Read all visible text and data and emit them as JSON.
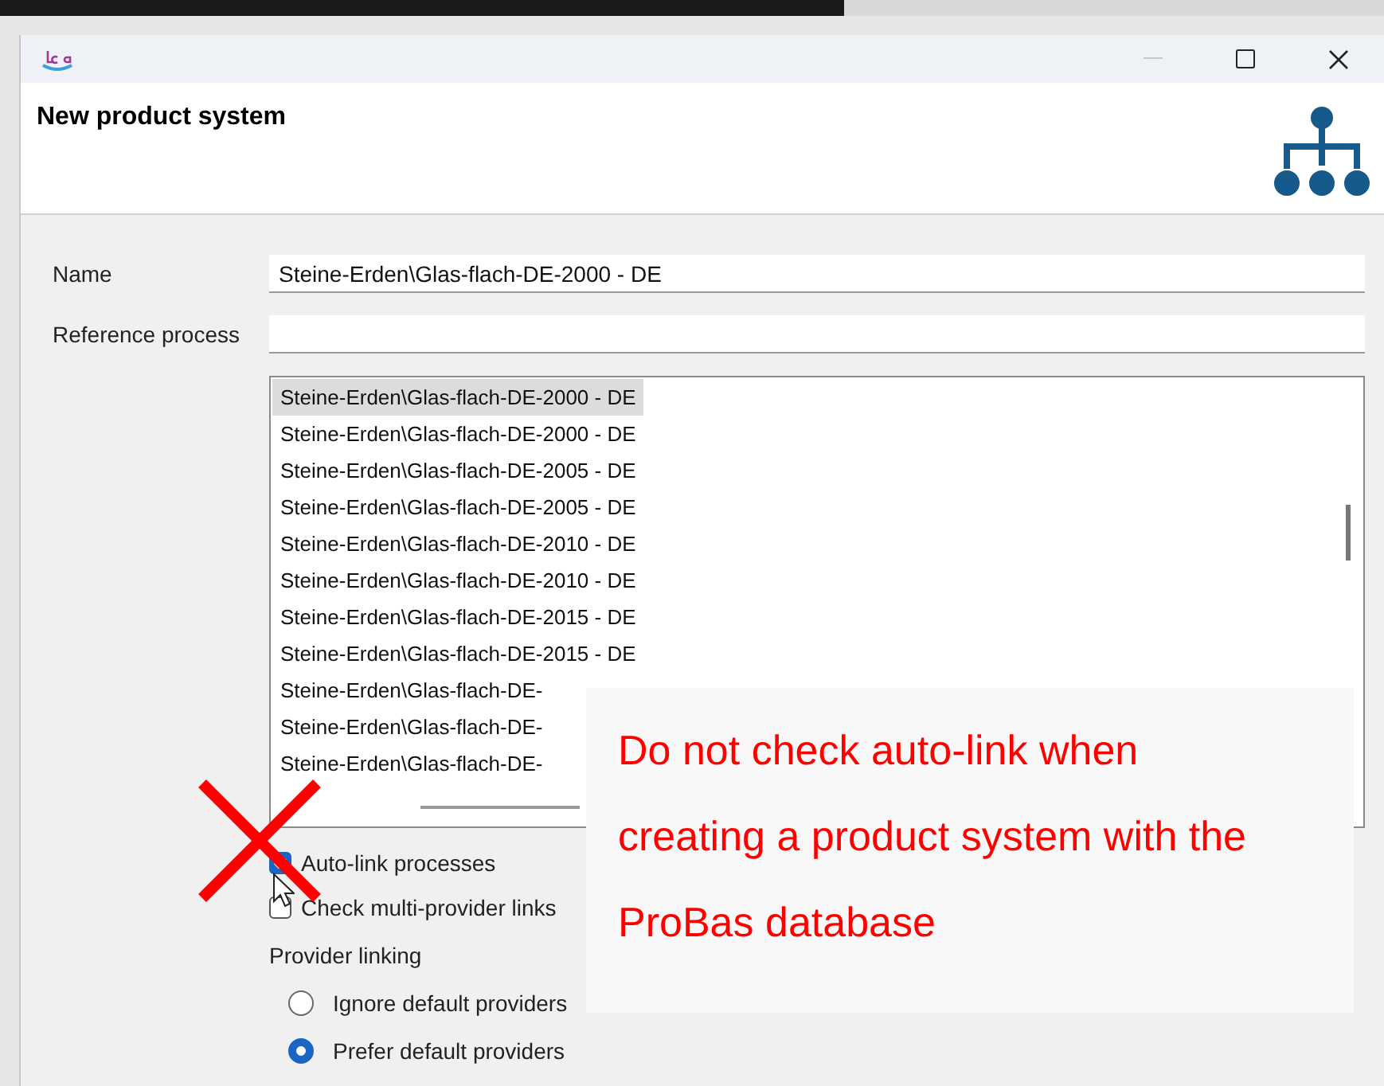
{
  "window": {
    "minimize_disabled": true,
    "title": "New product system"
  },
  "form": {
    "name_label": "Name",
    "name_value": "Steine-Erden\\Glas-flach-DE-2000 - DE",
    "reference_label": "Reference process"
  },
  "process_list": {
    "items": [
      {
        "label": "Steine-Erden\\Glas-flach-DE-2000 - DE",
        "selected": true
      },
      {
        "label": "Steine-Erden\\Glas-flach-DE-2000 - DE",
        "selected": false
      },
      {
        "label": "Steine-Erden\\Glas-flach-DE-2005 - DE",
        "selected": false
      },
      {
        "label": "Steine-Erden\\Glas-flach-DE-2005 - DE",
        "selected": false
      },
      {
        "label": "Steine-Erden\\Glas-flach-DE-2010 - DE",
        "selected": false
      },
      {
        "label": "Steine-Erden\\Glas-flach-DE-2010 - DE",
        "selected": false
      },
      {
        "label": "Steine-Erden\\Glas-flach-DE-2015 - DE",
        "selected": false
      },
      {
        "label": "Steine-Erden\\Glas-flach-DE-2015 - DE",
        "selected": false
      },
      {
        "label": "Steine-Erden\\Glas-flach-DE-",
        "selected": false
      },
      {
        "label": "Steine-Erden\\Glas-flach-DE-",
        "selected": false
      },
      {
        "label": "Steine-Erden\\Glas-flach-DE-",
        "selected": false
      }
    ]
  },
  "options": [
    {
      "label": "Auto-link processes",
      "checked": true
    },
    {
      "label": "Check multi-provider links",
      "checked": false
    }
  ],
  "provider_linking": {
    "label": "Provider linking",
    "options": [
      {
        "label": "Ignore default providers",
        "selected": false
      },
      {
        "label": "Prefer default providers",
        "selected": true
      }
    ]
  },
  "annotation": {
    "text": "Do not check auto-link when creating a product system with the ProBas database"
  }
}
